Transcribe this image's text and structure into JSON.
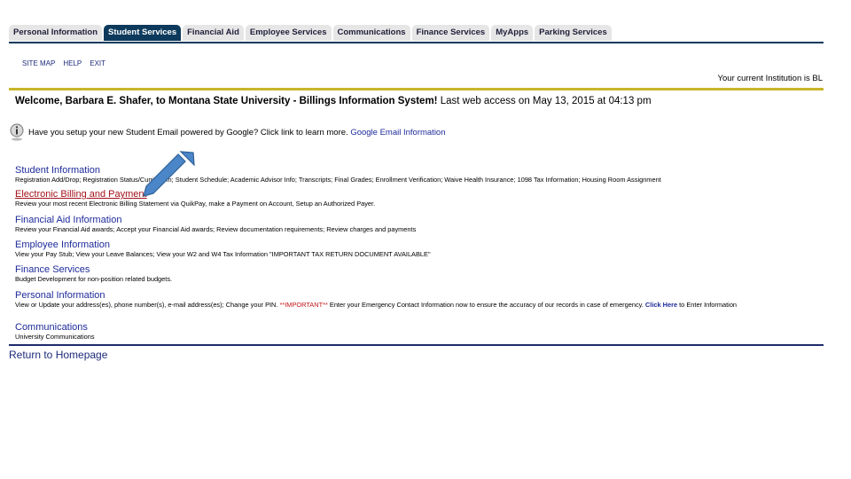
{
  "tabs": [
    {
      "label": "Personal Information",
      "active": false
    },
    {
      "label": "Student Services",
      "active": true
    },
    {
      "label": "Financial Aid",
      "active": false
    },
    {
      "label": "Employee Services",
      "active": false
    },
    {
      "label": "Communications",
      "active": false
    },
    {
      "label": "Finance Services",
      "active": false
    },
    {
      "label": "MyApps",
      "active": false
    },
    {
      "label": "Parking Services",
      "active": false
    }
  ],
  "util_links": {
    "site_map": "SITE MAP",
    "help": "HELP",
    "exit": "EXIT"
  },
  "institution_text": "Your current Institution is BL",
  "welcome": {
    "bold": "Welcome, Barbara E. Shafer, to Montana State University - Billings Information System!",
    "rest": " Last web access on May 13, 2015 at 04:13 pm"
  },
  "info_notice": {
    "text": "Have you setup your new Student Email powered by Google? Click link to learn more.",
    "link": "Google Email Information",
    "icon": "info-icon"
  },
  "sections": [
    {
      "title": "Student Information",
      "desc": "Registration Add/Drop; Registration Status/Curriculum; Student Schedule; Academic Advisor Info; Transcripts; Final Grades; Enrollment Verification; Waive Health Insurance; 1098 Tax Information; Housing Room Assignment"
    },
    {
      "title": "Electronic Billing and Payment",
      "desc": "Review your most recent Electronic Billing Statement via QuikPay, make a Payment on Account, Setup an Authorized Payer."
    },
    {
      "title": "Financial Aid Information",
      "desc": "Review your Financial Aid awards; Accept your Financial Aid awards; Review documentation requirements; Review charges and payments"
    },
    {
      "title": "Employee Information",
      "desc": "View your Pay Stub; View your Leave Balances; View your W2 and W4 Tax Information \"IMPORTANT TAX RETURN DOCUMENT AVAILABLE\""
    },
    {
      "title": "Finance Services",
      "desc": "Budget Development for non-position related budgets."
    },
    {
      "title": "Personal Information",
      "desc_pre": "View or Update your address(es), phone number(s), e-mail address(es); Change your PIN. ",
      "desc_important": "**IMPORTANT**",
      "desc_mid": " Enter your Emergency Contact Information now to ensure the accuracy of our records in case of emergency. ",
      "desc_link": "Click Here",
      "desc_post": " to Enter Information"
    },
    {
      "title": "Communications",
      "desc": "University Communications"
    }
  ],
  "return_link": "Return to Homepage",
  "colors": {
    "tab_active": "#0d3a5c",
    "tab_inactive": "#e6e6e6",
    "gold_rule": "#c9b52a",
    "link_blue": "#1d2b9a",
    "highlight_red": "#a3111a",
    "arrow_blue": "#4a86c8"
  }
}
